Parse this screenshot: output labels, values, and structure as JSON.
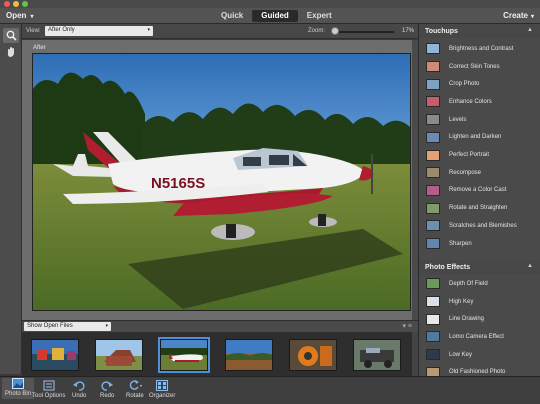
{
  "header": {
    "open_label": "Open",
    "modes": [
      "Quick",
      "Guided",
      "Expert"
    ],
    "active_mode": "Guided",
    "create_label": "Create"
  },
  "viewbar": {
    "view_label": "View:",
    "view_value": "After Only",
    "zoom_label": "Zoom:",
    "zoom_value": "17%",
    "zoom_fraction": 0.17
  },
  "canvas": {
    "after_label": "After",
    "photo_text": "N5165S"
  },
  "photobin": {
    "source_value": "Show Open Files",
    "thumbnails": [
      "harbor-boats",
      "red-barn",
      "airplane",
      "landscape-trees",
      "orange-machinery",
      "old-car"
    ],
    "selected_index": 2
  },
  "panel": {
    "touchups_title": "Touchups",
    "touchups": [
      {
        "label": "Brightness and Contrast",
        "color": "#8fb5d8"
      },
      {
        "label": "Correct Skin Tones",
        "color": "#d08a78"
      },
      {
        "label": "Crop Photo",
        "color": "#7ea1c4"
      },
      {
        "label": "Enhance Colors",
        "color": "#c95c6c"
      },
      {
        "label": "Levels",
        "color": "#8a8a8a"
      },
      {
        "label": "Lighten and Darken",
        "color": "#6b8bb5"
      },
      {
        "label": "Perfect Portrait",
        "color": "#e3a072"
      },
      {
        "label": "Recompose",
        "color": "#9a8b6a"
      },
      {
        "label": "Remove a Color Cast",
        "color": "#b35d8c"
      },
      {
        "label": "Rotate and Straighten",
        "color": "#7e9c6a"
      },
      {
        "label": "Scratches and Blemishes",
        "color": "#6c8fb0"
      },
      {
        "label": "Sharpen",
        "color": "#5f86b0"
      }
    ],
    "effects_title": "Photo Effects",
    "effects": [
      {
        "label": "Depth Of Field",
        "color": "#6a9a5a"
      },
      {
        "label": "High Key",
        "color": "#d8dfe6"
      },
      {
        "label": "Line Drawing",
        "color": "#e8e8e8"
      },
      {
        "label": "Lomo Camera Effect",
        "color": "#4e7aa0"
      },
      {
        "label": "Low Key",
        "color": "#2e3a4a"
      },
      {
        "label": "Old Fashioned Photo",
        "color": "#b79a74"
      }
    ]
  },
  "bottombar": {
    "photo_bin": "Photo Bin",
    "tool_options": "Tool Options",
    "undo": "Undo",
    "redo": "Redo",
    "rotate": "Rotate",
    "organizer": "Organizer"
  }
}
